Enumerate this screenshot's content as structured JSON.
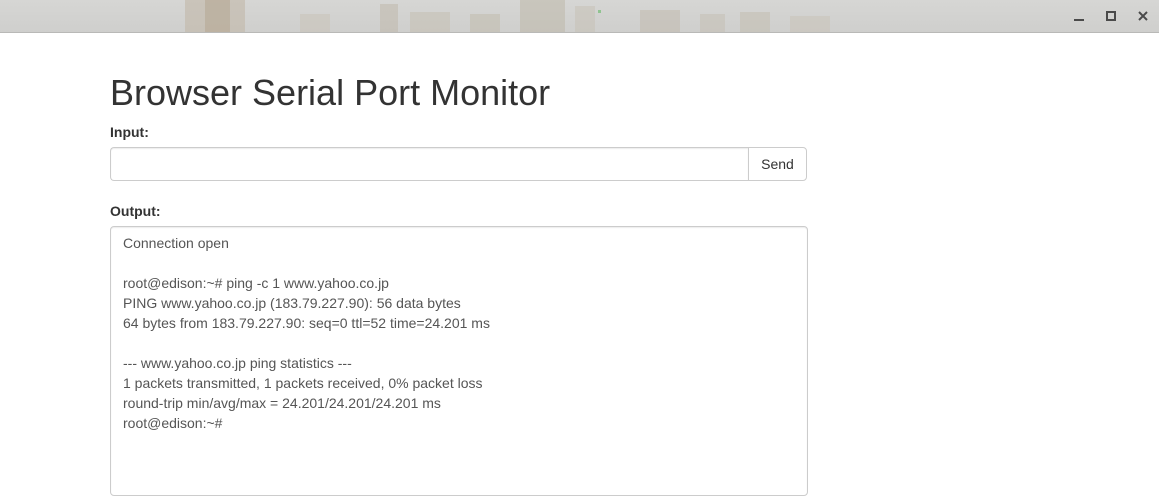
{
  "window": {
    "controls": {
      "minimize": "minimize-icon",
      "maximize": "maximize-icon",
      "close": "close-icon"
    }
  },
  "page": {
    "title": "Browser Serial Port Monitor",
    "input_label": "Input:",
    "input_value": "",
    "send_label": "Send",
    "output_label": "Output:"
  },
  "output": {
    "lines": [
      "Connection open",
      "",
      "root@edison:~# ping -c 1 www.yahoo.co.jp",
      "PING www.yahoo.co.jp (183.79.227.90): 56 data bytes",
      "64 bytes from 183.79.227.90: seq=0 ttl=52 time=24.201 ms",
      "",
      "--- www.yahoo.co.jp ping statistics ---",
      "1 packets transmitted, 1 packets received, 0% packet loss",
      "round-trip min/avg/max = 24.201/24.201/24.201 ms",
      "root@edison:~#"
    ]
  }
}
